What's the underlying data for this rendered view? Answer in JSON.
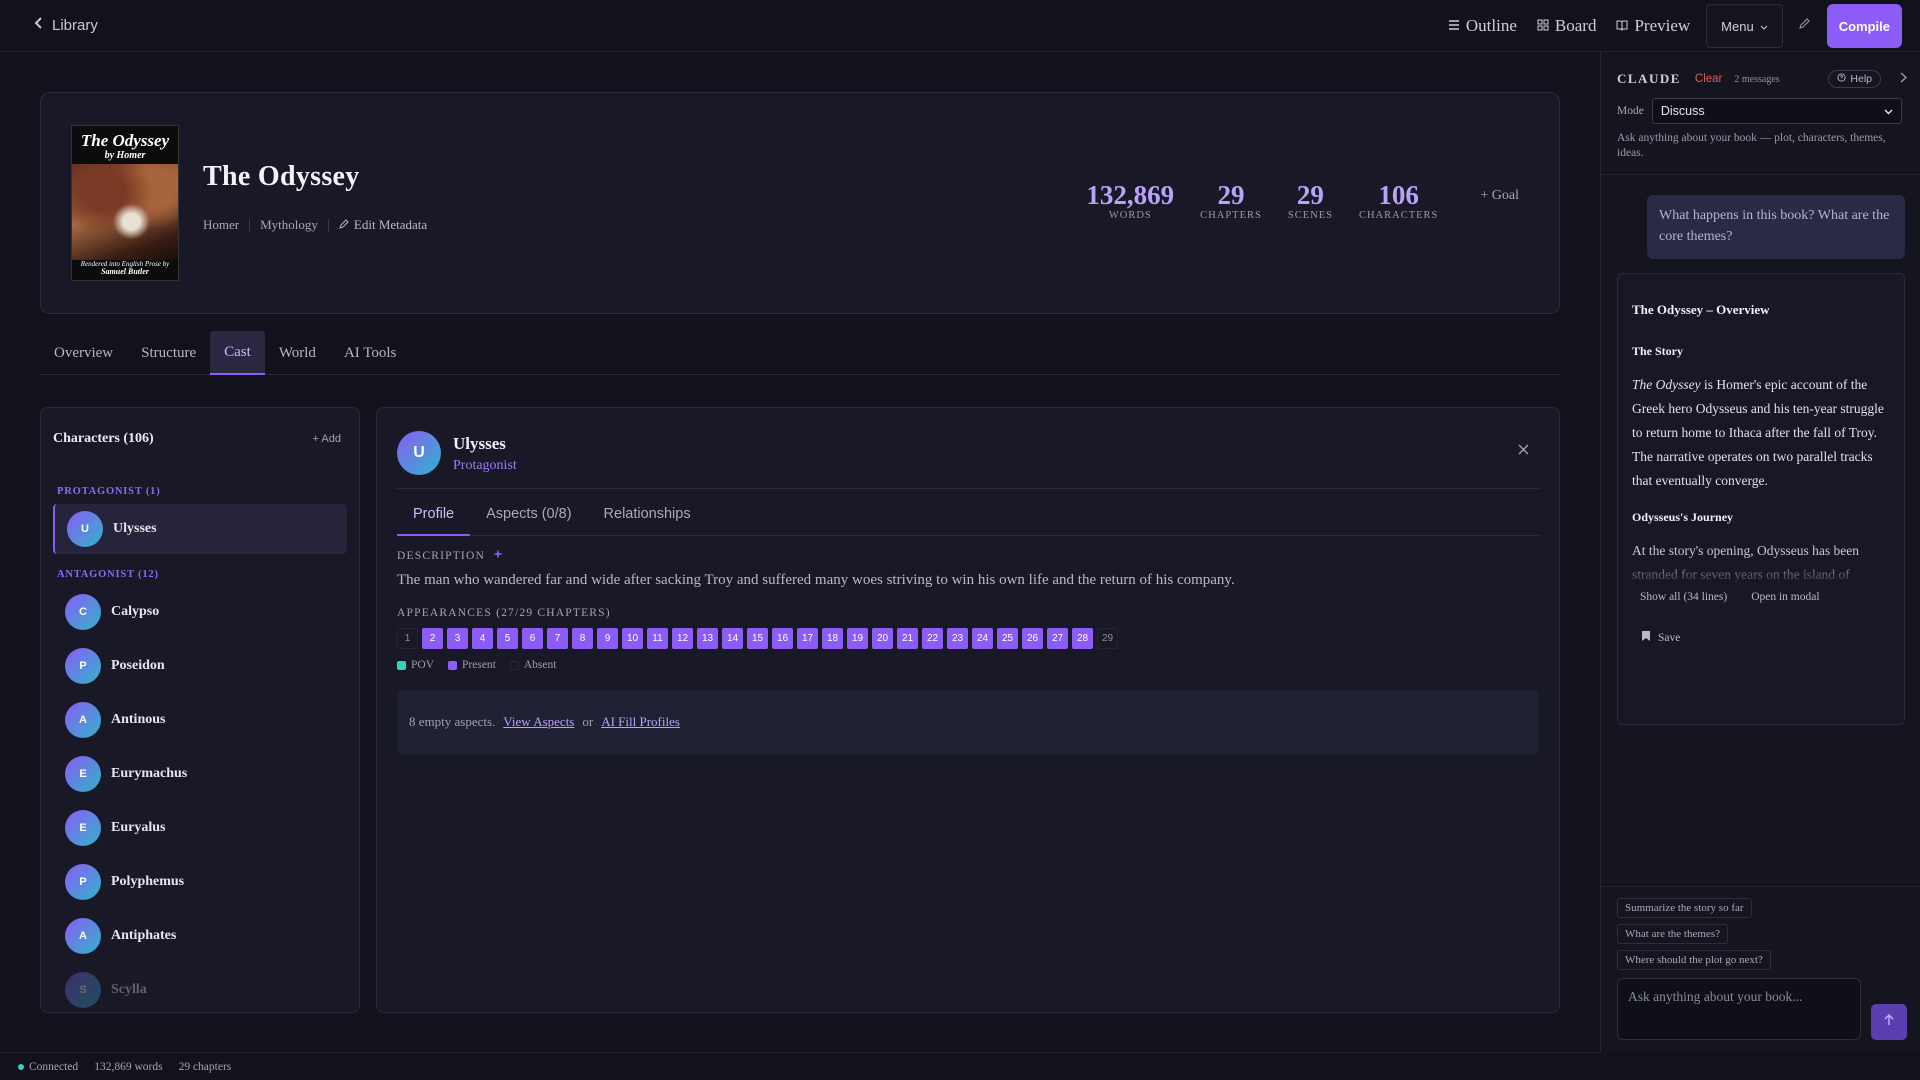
{
  "topbar": {
    "back_label": "Library",
    "nav": [
      "Outline",
      "Board",
      "Preview"
    ],
    "menu_label": "Menu",
    "compile_label": "Compile"
  },
  "book": {
    "cover_title": "The Odyssey",
    "cover_subtitle": "by Homer",
    "cover_footer_line1": "Rendered into English Prose by",
    "cover_footer_line2": "Samuel Butler",
    "title": "The Odyssey",
    "author": "Homer",
    "genre": "Mythology",
    "edit_label": "Edit Metadata",
    "stats": [
      {
        "value": "132,869",
        "label": "WORDS"
      },
      {
        "value": "29",
        "label": "CHAPTERS"
      },
      {
        "value": "29",
        "label": "SCENES"
      },
      {
        "value": "106",
        "label": "CHARACTERS"
      }
    ],
    "goal_label": "+ Goal"
  },
  "tabs": [
    {
      "label": "Overview",
      "active": false
    },
    {
      "label": "Structure",
      "active": false
    },
    {
      "label": "Cast",
      "active": true
    },
    {
      "label": "World",
      "active": false
    },
    {
      "label": "AI Tools",
      "active": false
    }
  ],
  "characters": {
    "title": "Characters (106)",
    "add_label": "+ Add",
    "protagonist_label": "PROTAGONIST (1)",
    "antagonist_label": "ANTAGONIST (12)",
    "protagonists": [
      {
        "initial": "U",
        "name": "Ulysses"
      }
    ],
    "antagonists": [
      {
        "initial": "C",
        "name": "Calypso"
      },
      {
        "initial": "P",
        "name": "Poseidon"
      },
      {
        "initial": "A",
        "name": "Antinous"
      },
      {
        "initial": "E",
        "name": "Eurymachus"
      },
      {
        "initial": "E",
        "name": "Euryalus"
      },
      {
        "initial": "P",
        "name": "Polyphemus"
      },
      {
        "initial": "A",
        "name": "Antiphates"
      },
      {
        "initial": "S",
        "name": "Scylla"
      }
    ]
  },
  "detail": {
    "initial": "U",
    "name": "Ulysses",
    "role": "Protagonist",
    "subtabs": [
      "Profile",
      "Aspects (0/8)",
      "Relationships"
    ],
    "description_label": "DESCRIPTION",
    "description": "The man who wandered far and wide after sacking Troy and suffered many woes striving to win his own life and the return of his company.",
    "appearances_label": "APPEARANCES (27/29 CHAPTERS)",
    "chapters": [
      {
        "n": "1",
        "state": "absent"
      },
      {
        "n": "2",
        "state": "present"
      },
      {
        "n": "3",
        "state": "present"
      },
      {
        "n": "4",
        "state": "present"
      },
      {
        "n": "5",
        "state": "present"
      },
      {
        "n": "6",
        "state": "present"
      },
      {
        "n": "7",
        "state": "present"
      },
      {
        "n": "8",
        "state": "present"
      },
      {
        "n": "9",
        "state": "present"
      },
      {
        "n": "10",
        "state": "present"
      },
      {
        "n": "11",
        "state": "present"
      },
      {
        "n": "12",
        "state": "present"
      },
      {
        "n": "13",
        "state": "present"
      },
      {
        "n": "14",
        "state": "present"
      },
      {
        "n": "15",
        "state": "present"
      },
      {
        "n": "16",
        "state": "present"
      },
      {
        "n": "17",
        "state": "present"
      },
      {
        "n": "18",
        "state": "present"
      },
      {
        "n": "19",
        "state": "present"
      },
      {
        "n": "20",
        "state": "present"
      },
      {
        "n": "21",
        "state": "present"
      },
      {
        "n": "22",
        "state": "present"
      },
      {
        "n": "23",
        "state": "present"
      },
      {
        "n": "24",
        "state": "present"
      },
      {
        "n": "25",
        "state": "present"
      },
      {
        "n": "26",
        "state": "present"
      },
      {
        "n": "27",
        "state": "present"
      },
      {
        "n": "28",
        "state": "present"
      },
      {
        "n": "29",
        "state": "absent"
      }
    ],
    "legend": {
      "pov": "POV",
      "present": "Present",
      "absent": "Absent"
    },
    "colors": {
      "pov": "#2dd4bf",
      "present": "#8b5cf6"
    },
    "empty_text": "8 empty aspects.",
    "view_aspects": "View Aspects",
    "or": "or",
    "ai_fill": "AI Fill Profiles"
  },
  "assistant": {
    "brand": "CLAUDE",
    "clear_label": "Clear",
    "message_count": "2 messages",
    "help_label": "Help",
    "mode_label": "Mode",
    "mode_value": "Discuss",
    "hint": "Ask anything about your book — plot, characters, themes, ideas.",
    "user_message": "What happens in this book?  What are the core themes?",
    "response": {
      "heading": "The Odyssey – Overview",
      "section1": "The Story",
      "para_title": "The Odyssey",
      "para_rest": " is Homer's epic account of the Greek hero Odysseus and his ten-year struggle to return home to Ithaca after the fall of Troy. The narrative operates on two parallel tracks that eventually converge.",
      "section2": "Odysseus's Journey",
      "fade_text": "At the story's opening, Odysseus has been stranded for seven years on the island of",
      "show_all": "Show all (34 lines)",
      "open_modal": "Open in modal",
      "save": "Save"
    },
    "suggestions": [
      "Summarize the story so far",
      "What are the themes?",
      "Where should the plot go next?"
    ],
    "input_placeholder": "Ask anything about your book..."
  },
  "status": {
    "connection": "Connected",
    "words": "132,869 words",
    "chapters": "29 chapters"
  }
}
